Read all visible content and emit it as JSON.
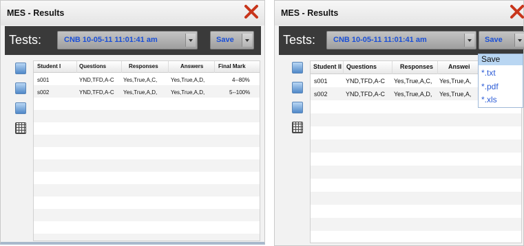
{
  "window": {
    "title": "MES - Results",
    "tests_label": "Tests:",
    "test_select_value": "CNB    10-05-11 11:01:41 am",
    "save_label": "Save"
  },
  "table": {
    "columns": [
      "Student I",
      "Questions",
      "Responses",
      "Answers",
      "Final Mark"
    ],
    "rows": [
      [
        "s001",
        "YND,TFD,A-C",
        "Yes,True,A,C,",
        "Yes,True,A,D,",
        "4--80%"
      ],
      [
        "s002",
        "YND,TFD,A-C",
        "Yes,True,A,D,",
        "Yes,True,A,D,",
        "5--100%"
      ]
    ],
    "right_headers": [
      "Student II",
      "Questions",
      "Responses",
      "Answei"
    ],
    "right_rows": [
      [
        "s001",
        "YND,TFD,A-C",
        "Yes,True,A,C,",
        "Yes,True,A,"
      ],
      [
        "s002",
        "YND,TFD,A-C",
        "Yes,True,A,D,",
        "Yes,True,A,"
      ]
    ]
  },
  "sidebar": {
    "icons": [
      "chart-icon",
      "bar-chart-icon",
      "report-icon",
      "grid-icon"
    ]
  },
  "save_menu": {
    "items": [
      "Save",
      "*.txt",
      "*.pdf",
      "*.xls"
    ]
  },
  "colors": {
    "accent": "#1a4fd6",
    "toolbar": "#3a3a3a",
    "close": "#c8351b",
    "menu_highlight": "#b9d6f2"
  }
}
